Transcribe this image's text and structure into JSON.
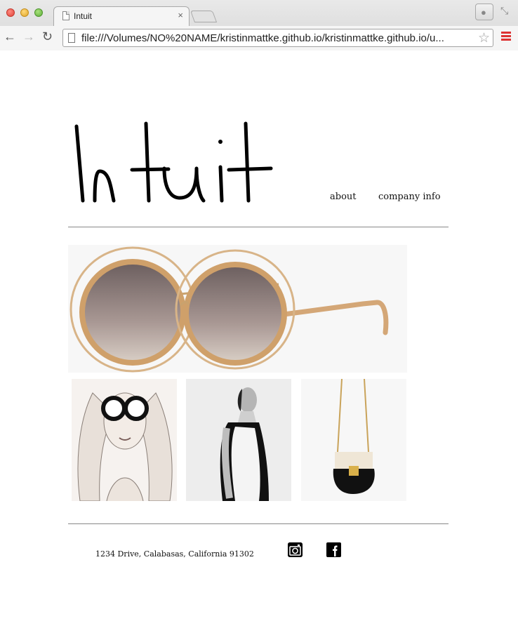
{
  "browser": {
    "tab_title": "Intuit",
    "tab_close": "×",
    "url": "file:///Volumes/NO%20NAME/kristinmattke.github.io/kristinmattke.github.io/u...",
    "back": "←",
    "forward": "→",
    "reload": "↻",
    "star": "☆",
    "profile": "👤",
    "fullscreen": "⤡"
  },
  "header": {
    "logo_text": "Intuit",
    "nav": [
      {
        "label": "about"
      },
      {
        "label": "company info"
      }
    ]
  },
  "gallery": {
    "hero": "round-sunglasses-image",
    "thumbs": [
      "sketch-girl-glasses-image",
      "model-dress-image",
      "black-handbag-image"
    ]
  },
  "footer": {
    "address": "1234 Drive, Calabasas, California 91302",
    "social": [
      "instagram-icon",
      "facebook-icon"
    ]
  }
}
